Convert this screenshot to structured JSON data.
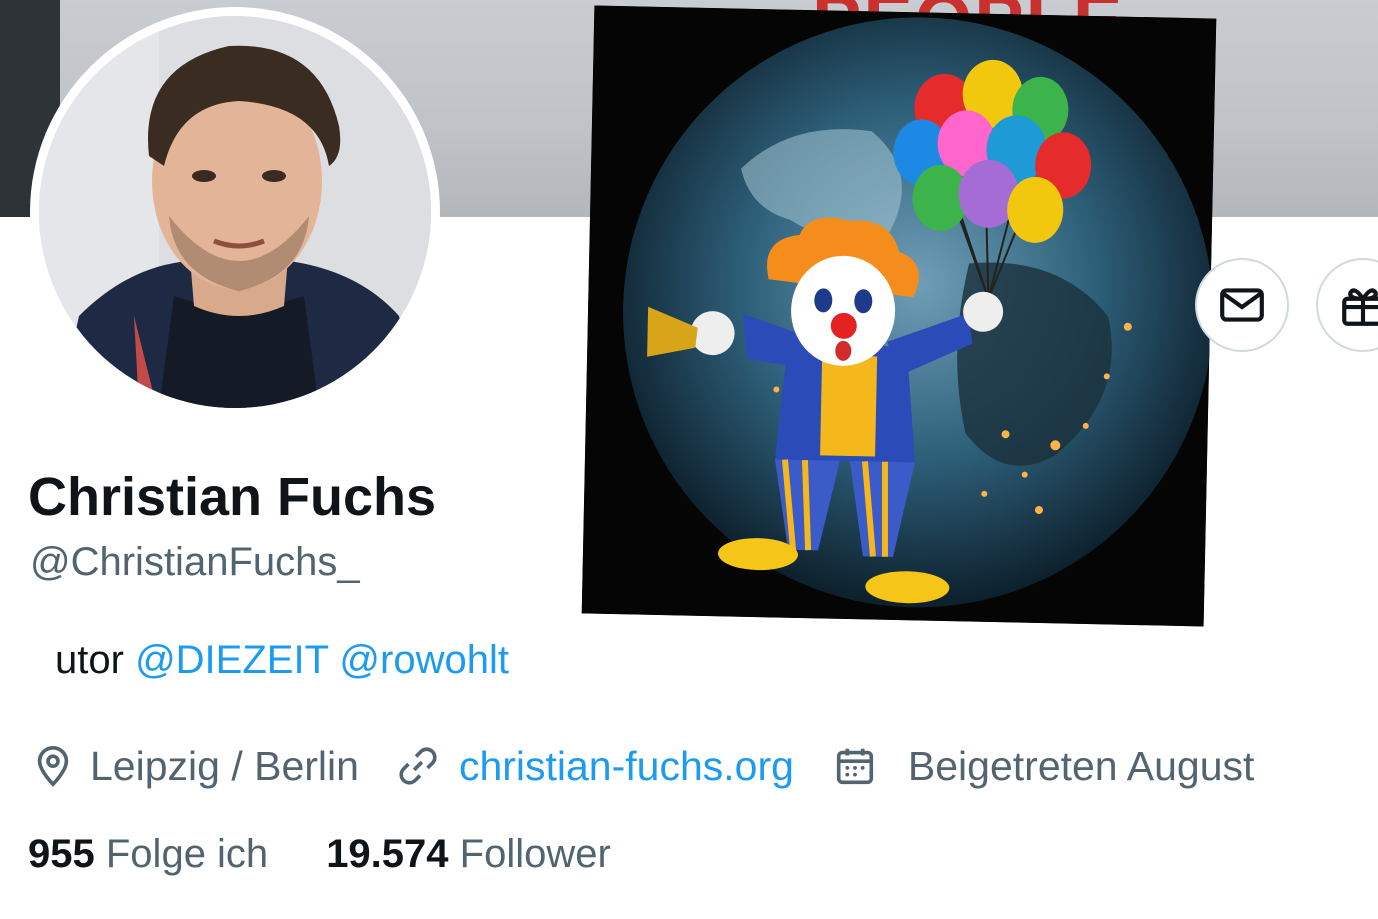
{
  "banner": {
    "text": "PEOPLE"
  },
  "profile": {
    "display_name": "Christian Fuchs",
    "handle": "@ChristianFuchs_",
    "bio": {
      "prefix": "utor",
      "mentions": [
        "@DIEZEIT",
        "@rowohlt"
      ]
    },
    "location": "Leipzig / Berlin",
    "website": "christian-fuchs.org",
    "joined": "Beigetreten August"
  },
  "stats": {
    "following_count": "955",
    "following_label": "Folge ich",
    "followers_count": "19.574",
    "followers_label": "Follower"
  },
  "actions": {
    "message_icon": "mail-icon",
    "gift_icon": "gift-icon"
  },
  "colors": {
    "accent": "#1d9bf0",
    "text": "#0f1419",
    "secondary": "#536471",
    "banner_text": "#c8312d"
  }
}
